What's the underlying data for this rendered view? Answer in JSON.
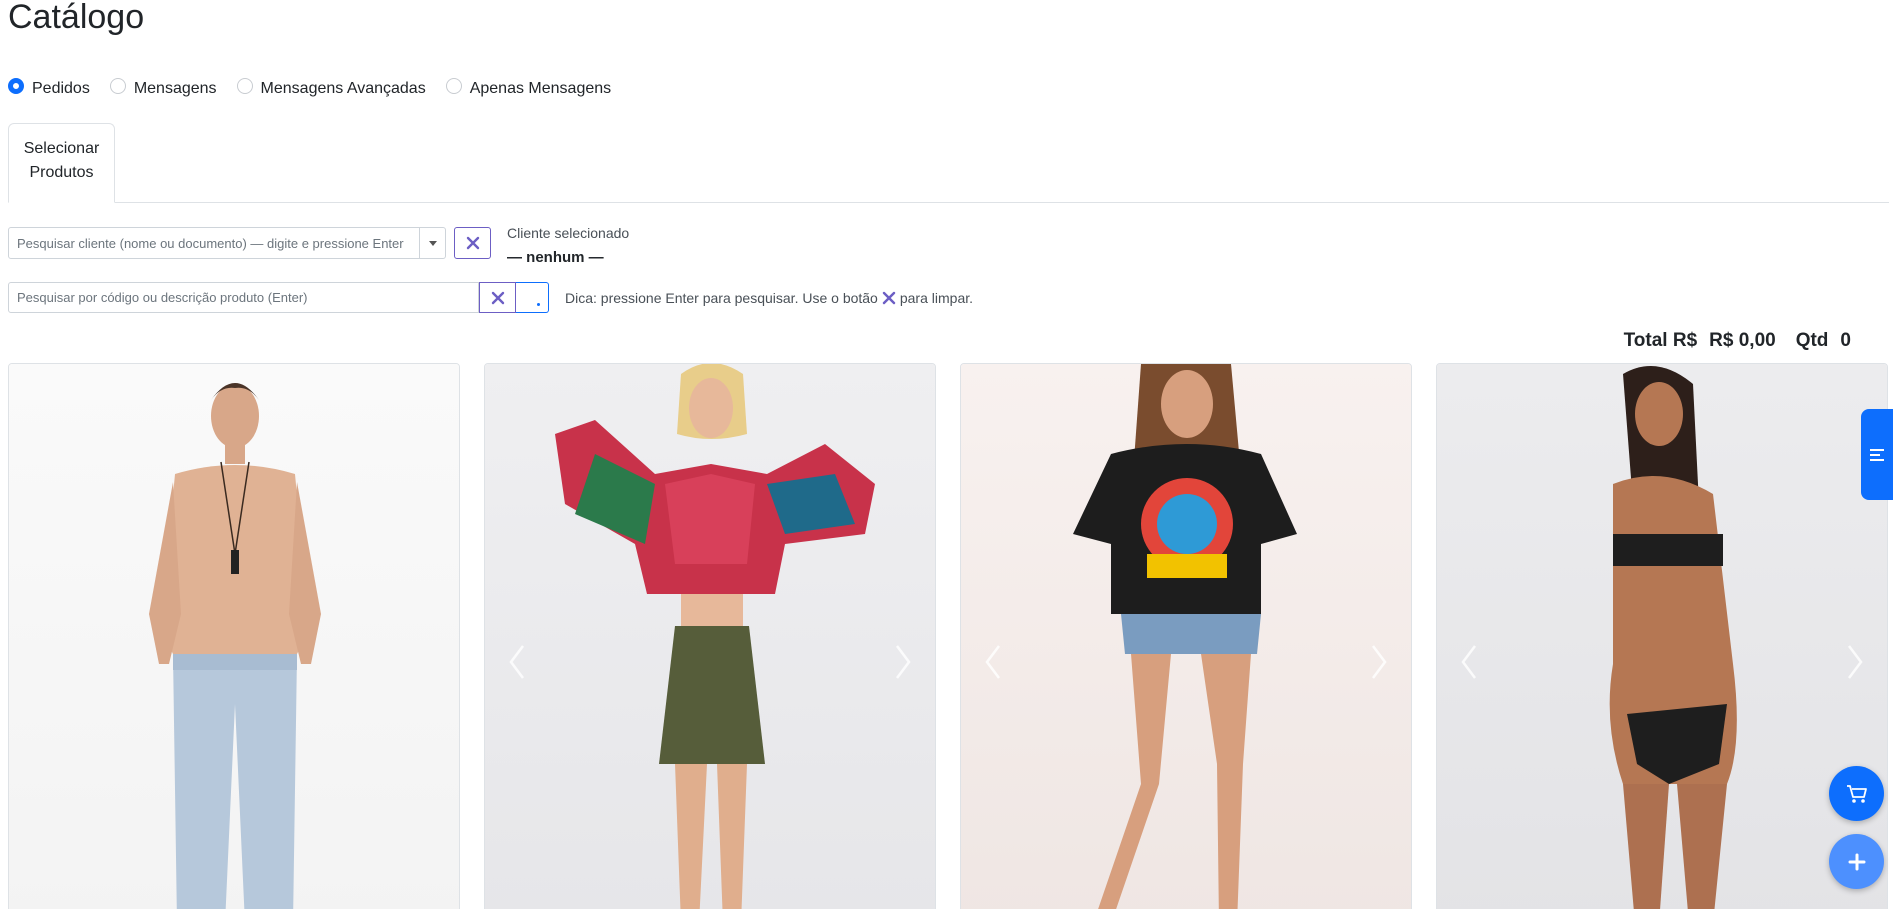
{
  "page": {
    "title": "Catálogo"
  },
  "modes": {
    "options": [
      {
        "label": "Pedidos",
        "checked": true
      },
      {
        "label": "Mensagens",
        "checked": false
      },
      {
        "label": "Mensagens Avançadas",
        "checked": false
      },
      {
        "label": "Apenas Mensagens",
        "checked": false
      }
    ]
  },
  "tabs": [
    {
      "line1": "Selecionar",
      "line2": "Produtos"
    }
  ],
  "cliente": {
    "placeholder": "Pesquisar cliente (nome ou documento) — digite e pressione Enter",
    "selected_caption": "Cliente selecionado",
    "selected_value": "— nenhum —"
  },
  "produto": {
    "placeholder": "Pesquisar por código ou descrição produto (Enter)",
    "hint_before": "Dica: pressione Enter para pesquisar. Use o botão",
    "hint_after": "para limpar."
  },
  "totals": {
    "total_label": "Total R$",
    "total_value": "R$ 0,00",
    "qty_label": "Qtd",
    "qty_value": "0"
  },
  "products": [
    {
      "image": "man-jeans-photo",
      "has_carousel_controls": false
    },
    {
      "image": "woman-floral-top-skirt-photo",
      "has_carousel_controls": true
    },
    {
      "image": "woman-frevo-axe-tshirt-photo",
      "has_carousel_controls": true
    },
    {
      "image": "woman-black-bikini-photo",
      "has_carousel_controls": true
    }
  ],
  "colors": {
    "primary": "#0d6efd",
    "clear_icon": "#6c5ec4",
    "fab_plus": "#4d90fe"
  },
  "icons": {
    "side_tab": "menu-lines-icon",
    "fab_cart": "cart-icon",
    "fab_plus": "plus-icon",
    "clear": "x-icon"
  }
}
